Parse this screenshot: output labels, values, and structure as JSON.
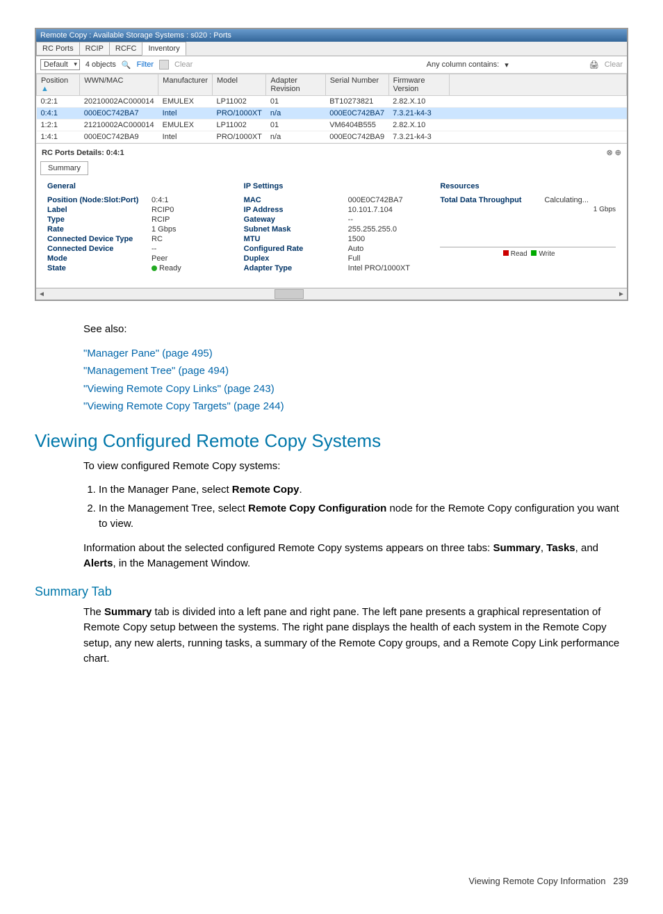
{
  "window": {
    "title": "Remote Copy : Available Storage Systems : s020 : Ports",
    "tabs": [
      "RC Ports",
      "RCIP",
      "RCFC",
      "Inventory"
    ],
    "active_tab": 3
  },
  "toolbar": {
    "template_value": "Default",
    "objects_count": "4 objects",
    "filter": "Filter",
    "clear": "Clear",
    "any_column": "Any column contains:",
    "clear_right": "Clear"
  },
  "columns": [
    "Position",
    "WWN/MAC",
    "Manufacturer",
    "Model",
    "Adapter Revision",
    "Serial Number",
    "Firmware Version"
  ],
  "rows": [
    {
      "position": "0:2:1",
      "wwn": "20210002AC000014",
      "mfr": "EMULEX",
      "model": "LP11002",
      "rev": "01",
      "serial": "BT10273821",
      "fw": "2.82.X.10",
      "sel": false
    },
    {
      "position": "0:4:1",
      "wwn": "000E0C742BA7",
      "mfr": "Intel",
      "model": "PRO/1000XT",
      "rev": "n/a",
      "serial": "000E0C742BA7",
      "fw": "7.3.21-k4-3",
      "sel": true
    },
    {
      "position": "1:2:1",
      "wwn": "21210002AC000014",
      "mfr": "EMULEX",
      "model": "LP11002",
      "rev": "01",
      "serial": "VM6404B555",
      "fw": "2.82.X.10",
      "sel": false
    },
    {
      "position": "1:4:1",
      "wwn": "000E0C742BA9",
      "mfr": "Intel",
      "model": "PRO/1000XT",
      "rev": "n/a",
      "serial": "000E0C742BA9",
      "fw": "7.3.21-k4-3",
      "sel": false
    }
  ],
  "details": {
    "title": "RC Ports Details: 0:4:1",
    "sub_tab": "Summary",
    "general": {
      "heading": "General",
      "items": [
        {
          "label": "Position (Node:Slot:Port)",
          "value": "0:4:1"
        },
        {
          "label": "Label",
          "value": "RCIP0"
        },
        {
          "label": "Type",
          "value": "RCIP"
        },
        {
          "label": "Rate",
          "value": "1 Gbps"
        },
        {
          "label": "Connected Device Type",
          "value": "RC"
        },
        {
          "label": "Connected Device",
          "value": "--"
        },
        {
          "label": "Mode",
          "value": "Peer"
        },
        {
          "label": "State",
          "value": "Ready"
        }
      ]
    },
    "ip": {
      "heading": "IP Settings",
      "items": [
        {
          "label": "MAC",
          "value": "000E0C742BA7"
        },
        {
          "label": "IP Address",
          "value": "10.101.7.104"
        },
        {
          "label": "Gateway",
          "value": "--"
        },
        {
          "label": "Subnet Mask",
          "value": "255.255.255.0"
        },
        {
          "label": "MTU",
          "value": "1500"
        },
        {
          "label": "Configured Rate",
          "value": "Auto"
        },
        {
          "label": "Duplex",
          "value": "Full"
        },
        {
          "label": "Adapter Type",
          "value": "Intel PRO/1000XT"
        }
      ]
    },
    "resources": {
      "heading": "Resources",
      "throughput_label": "Total Data Throughput",
      "throughput_value": "Calculating...",
      "y_max": "1 Gbps",
      "legend_read": "Read",
      "legend_write": "Write"
    }
  },
  "doc": {
    "see_also": "See also:",
    "links": [
      "\"Manager Pane\" (page 495)",
      "\"Management Tree\" (page 494)",
      "\"Viewing Remote Copy Links\" (page 243)",
      "\"Viewing Remote Copy Targets\" (page 244)"
    ],
    "h1": "Viewing Configured Remote Copy Systems",
    "intro": "To view configured Remote Copy systems:",
    "step1_a": "In the Manager Pane, select ",
    "step1_b": "Remote Copy",
    "step1_c": ".",
    "step2_a": "In the Management Tree, select ",
    "step2_b": "Remote Copy Configuration",
    "step2_c": " node for the Remote Copy configuration you want to view.",
    "para_a": "Information about the selected configured Remote Copy systems appears on three tabs: ",
    "para_b": "Summary",
    "para_c": ", ",
    "para_d": "Tasks",
    "para_e": ", and ",
    "para_f": "Alerts",
    "para_g": ", in the Management Window.",
    "h2": "Summary Tab",
    "summary_para_a": "The ",
    "summary_para_b": "Summary",
    "summary_para_c": " tab is divided into a left pane and right pane. The left pane presents a graphical representation of Remote Copy setup between the systems. The right pane displays the health of each system in the Remote Copy setup, any new alerts, running tasks, a summary of the Remote Copy groups, and a Remote Copy Link performance chart.",
    "footer_text": "Viewing Remote Copy Information",
    "page_no": "239"
  }
}
